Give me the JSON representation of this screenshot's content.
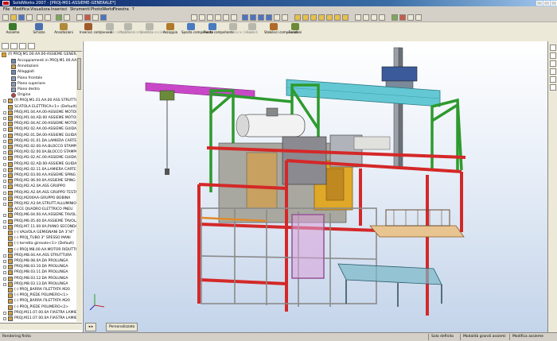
{
  "window": {
    "title": "SolidWorks 2007 - [PROJ-M01-ASSIEME-GENERALE*]"
  },
  "menu": [
    "File",
    "Modifica",
    "Visualizza",
    "Inserisci",
    "Strumenti",
    "PhotoWorks",
    "Finestra",
    "?"
  ],
  "command_manager": [
    {
      "label": "Assieme",
      "enabled": true,
      "color": "#3a7a2a"
    },
    {
      "label": "Schizzo",
      "enabled": true,
      "color": "#4a6fb0"
    },
    {
      "label": "Annotazioni",
      "enabled": true,
      "color": "#b08a3a"
    },
    {
      "label": "Inserisci componenti",
      "enabled": true,
      "color": "#a05a2a"
    },
    {
      "label": "Nascondi componenti",
      "enabled": false,
      "color": "#7a7a7a"
    },
    {
      "label": "Modifica componente",
      "enabled": false,
      "color": "#7a7a7a"
    },
    {
      "label": "Modifica assieme",
      "enabled": false,
      "color": "#7a7a7a"
    },
    {
      "label": "Accoppia",
      "enabled": true,
      "color": "#b07a2a"
    },
    {
      "label": "Sposta componente",
      "enabled": true,
      "color": "#4a7ac0"
    },
    {
      "label": "Ruota componente",
      "enabled": true,
      "color": "#4a7ac0"
    },
    {
      "label": "Ripetizione lineare",
      "enabled": false,
      "color": "#7a7a7a"
    },
    {
      "label": "Esplodi",
      "enabled": false,
      "color": "#7a7a7a"
    },
    {
      "label": "Stabilisci componenti",
      "enabled": true,
      "color": "#b06a2a"
    },
    {
      "label": "Funzioni",
      "enabled": true,
      "color": "#6a8a3a"
    }
  ],
  "tree": {
    "root": "(f) PROJ.M1.00.AA.00-ASSIEME GENERALE",
    "items": [
      {
        "label": "Accoppiamenti in PROJ.M1.00.AA",
        "icon": "folder",
        "color": "#6a8ab0"
      },
      {
        "label": "Annotazioni",
        "icon": "annotation",
        "color": "#c8a040"
      },
      {
        "label": "Alloggiati",
        "icon": "folder",
        "color": "#6a8ab0"
      },
      {
        "label": "Piano frontale",
        "icon": "plane",
        "color": "#8a9ab8"
      },
      {
        "label": "Piano superiore",
        "icon": "plane",
        "color": "#8a9ab8"
      },
      {
        "label": "Piano destro",
        "icon": "plane",
        "color": "#8a9ab8"
      },
      {
        "label": "Origine",
        "icon": "origin",
        "color": "#c04040"
      },
      {
        "label": "(f) PROJ.M1.01.AA.00 ASS STRUTTURA",
        "icon": "assembly",
        "color": "#d0a040"
      },
      {
        "label": "SCATOLA ELETTRICA<1> (Default)",
        "icon": "part",
        "color": "#d0a040"
      },
      {
        "label": "PROJ.M1.04.AA.00-ASSIEME MOTORE",
        "icon": "assembly",
        "color": "#d0a040"
      },
      {
        "label": "PROJ.M1.04.AD.00 ASSIEME MOTORE",
        "icon": "assembly",
        "color": "#d0a040"
      },
      {
        "label": "PROJ.M2.04.AC.00-ASSIEME MOTORE",
        "icon": "assembly",
        "color": "#d0a040"
      },
      {
        "label": "PROJ.M2.02.AA.00-ASSIEME GUIDA",
        "icon": "assembly",
        "color": "#d0a040"
      },
      {
        "label": "PROJ.M2.01.DA.00-ASSIEME GUIDA",
        "icon": "assembly",
        "color": "#d0a040"
      },
      {
        "label": "PROJ.M2.01.01.DA.LAMIERA CARTER",
        "icon": "assembly",
        "color": "#d0a040"
      },
      {
        "label": "PROJ.M2.02.00.AA.BLOCCO STAMPO",
        "icon": "assembly",
        "color": "#d0a040"
      },
      {
        "label": "PROJ.M2.02.00.0A.BLOCCO STAMPO",
        "icon": "assembly",
        "color": "#d0a040"
      },
      {
        "label": "PROJ.M2.02.AC.00-ASSIEME GUIDA",
        "icon": "assembly",
        "color": "#d0a040"
      },
      {
        "label": "PROJ.M2.02.AD.00-ASSIEME GUIDA",
        "icon": "assembly",
        "color": "#d0a040"
      },
      {
        "label": "PROJ.M2.02.11.0A.LAMIERA CARTER",
        "icon": "assembly",
        "color": "#d0a040"
      },
      {
        "label": "PROJ.M2.03.00.AA.ASSIEME SPING",
        "icon": "assembly",
        "color": "#d0a040"
      },
      {
        "label": "PROJ.M2.06.00.0A.ASSIEME SPING",
        "icon": "assembly",
        "color": "#d0a040"
      },
      {
        "label": "PROJ.M2.A2.0A.ASS GRUPPO",
        "icon": "assembly",
        "color": "#d0a040"
      },
      {
        "label": "PROJ.M2.A2.0A.ASS GRUPPO TESTA",
        "icon": "assembly",
        "color": "#d0a040"
      },
      {
        "label": "PROJ.M200AA-GRUPPO BOBINA",
        "icon": "assembly",
        "color": "#d0a040"
      },
      {
        "label": "PROJ.M2.A3.0A.STRUTT.ALLUMINIO",
        "icon": "assembly",
        "color": "#d0a040"
      },
      {
        "label": "ACCE QUADRO ELETTRICO PNEU",
        "icon": "part",
        "color": "#d0a040"
      },
      {
        "label": "PROJ.M6.04.00.AA.ASSIEME TAVOLA",
        "icon": "assembly",
        "color": "#d0a040"
      },
      {
        "label": "PROJ.M6.05.00.0A.ASSIEME TAVOLA",
        "icon": "assembly",
        "color": "#d0a040"
      },
      {
        "label": "PROJ.M7.11.00.0A.PIANO SECONDARIO",
        "icon": "assembly",
        "color": "#d0a040"
      },
      {
        "label": "(-) VALVOLA GEMIGNANI DA 3\"/4\"",
        "icon": "part",
        "color": "#d0a040"
      },
      {
        "label": "(-) PROJ_TUBO 3\" SPESSO MANI",
        "icon": "part",
        "color": "#d0a040"
      },
      {
        "label": "(-) torretta girevole<1> (Default)",
        "icon": "part",
        "color": "#d0a040"
      },
      {
        "label": "(-) PROJ.M8.00.AA.MOTOR RIDUTTORE",
        "icon": "part",
        "color": "#d0a040"
      },
      {
        "label": "PROJ.M8.04.AA.ASS STRUTTURA",
        "icon": "assembly",
        "color": "#d0a040"
      },
      {
        "label": "PROJ.M8.08.0A.DA PROLUNGA",
        "icon": "assembly",
        "color": "#d0a040"
      },
      {
        "label": "PROJ.M8.03.10.DA PROLUNGA",
        "icon": "assembly",
        "color": "#d0a040"
      },
      {
        "label": "PROJ.M8.03.11.DA PROLUNGA",
        "icon": "assembly",
        "color": "#d0a040"
      },
      {
        "label": "PROJ.M8.03.12.DA PROLUNGA",
        "icon": "assembly",
        "color": "#d0a040"
      },
      {
        "label": "PROJ.M8.03.13.DA PROLUNGA",
        "icon": "assembly",
        "color": "#d0a040"
      },
      {
        "label": "(-) PROJ_BARRA FILETTATA M20",
        "icon": "part",
        "color": "#d0a040"
      },
      {
        "label": "(-) PROJ_PIEDE POLIMERO<1>",
        "icon": "part",
        "color": "#d0a040"
      },
      {
        "label": "(-) PROJ_BARRA FILETTATA M20",
        "icon": "part",
        "color": "#d0a040"
      },
      {
        "label": "(-) PROJ_PIEDE POLIMERO<2>",
        "icon": "part",
        "color": "#d0a040"
      },
      {
        "label": "PROJ.M11.07.00.0A FIASTRA LAMIERA",
        "icon": "assembly",
        "color": "#d0a040"
      },
      {
        "label": "PROJ.M11.07.00.0A FIASTRA LAMIERA",
        "icon": "assembly",
        "color": "#d0a040"
      }
    ]
  },
  "viewport": {
    "tab_label": "Personalizzato",
    "frame_red": "#d42828",
    "frame_green": "#2e9a2e",
    "frame_yellow": "#e0a828",
    "frame_magenta": "#c848c8",
    "frame_cyan": "#64c8d4",
    "frame_gray": "#8a8a8a"
  },
  "status": {
    "left": "Rendering finito",
    "mode1": "Solo definito",
    "mode2": "Modalità grandi assiemi",
    "mode3": "Modifica assieme"
  }
}
